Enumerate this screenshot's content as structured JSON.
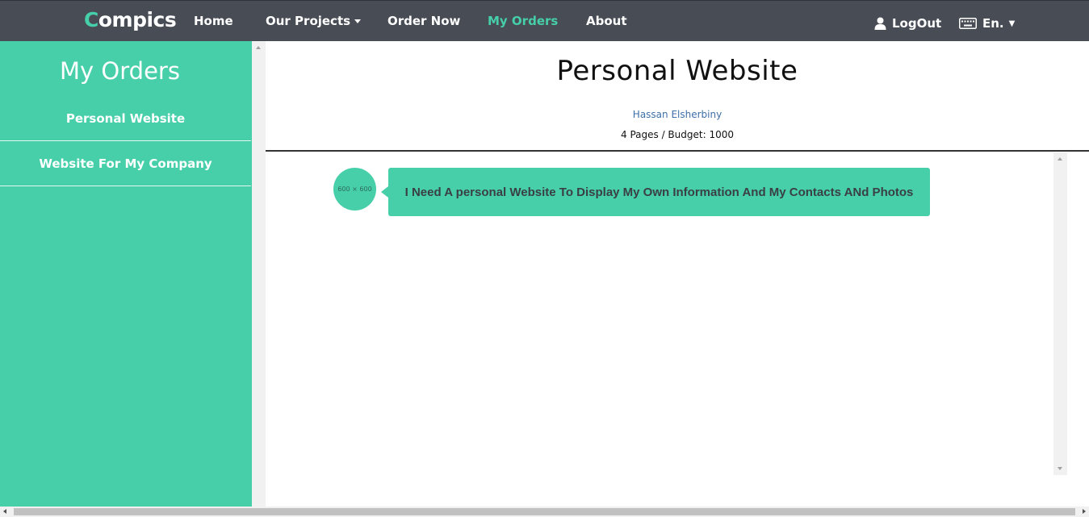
{
  "navbar": {
    "brand_first": "C",
    "brand_rest": "ompics",
    "items": [
      {
        "label": "Home"
      },
      {
        "label": "Our Projects"
      },
      {
        "label": "Order Now"
      },
      {
        "label": "My Orders"
      },
      {
        "label": "About"
      }
    ],
    "active_item": "My Orders",
    "logout_label": "LogOut",
    "language_label": "En."
  },
  "sidebar": {
    "title": "My Orders",
    "items": [
      {
        "label": "Personal Website"
      },
      {
        "label": "Website For My Company"
      }
    ]
  },
  "order": {
    "title": "Personal Website",
    "author": "Hassan Elsherbiny",
    "details": "4 Pages / Budget: 1000"
  },
  "messages": [
    {
      "avatar_placeholder": "600 × 600",
      "text": "I Need A personal Website To Display My Own Information And My Contacts ANd Photos"
    }
  ],
  "colors": {
    "accent": "#46cfa9",
    "navbar": "#484c55",
    "link": "#3d6fa8"
  }
}
